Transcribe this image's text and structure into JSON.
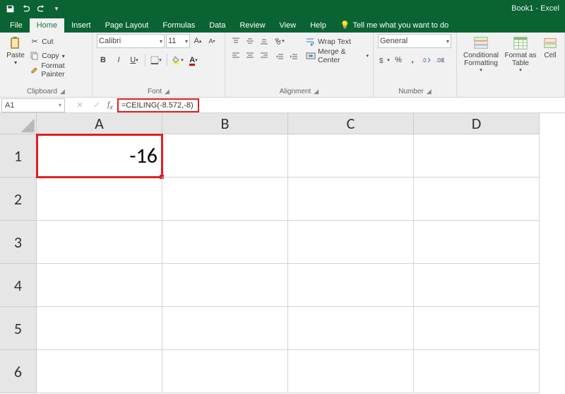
{
  "titlebar": {
    "doc_title": "Book1 - Excel"
  },
  "tabs": {
    "file": "File",
    "home": "Home",
    "insert": "Insert",
    "page_layout": "Page Layout",
    "formulas": "Formulas",
    "data": "Data",
    "review": "Review",
    "view": "View",
    "help": "Help",
    "tell_me": "Tell me what you want to do"
  },
  "clipboard": {
    "paste": "Paste",
    "cut": "Cut",
    "copy": "Copy",
    "format_painter": "Format Painter",
    "group": "Clipboard"
  },
  "font": {
    "name": "Calibri",
    "size": "11",
    "group": "Font"
  },
  "alignment": {
    "wrap": "Wrap Text",
    "merge": "Merge & Center",
    "group": "Alignment"
  },
  "number": {
    "format": "General",
    "group": "Number"
  },
  "styles": {
    "cond": "Conditional Formatting",
    "table": "Format as Table",
    "cell": "Cell"
  },
  "namebox": "A1",
  "formula": "=CEILING(-8.572,-8)",
  "columns": [
    "A",
    "B",
    "C",
    "D"
  ],
  "rows": [
    "1",
    "2",
    "3",
    "4",
    "5",
    "6"
  ],
  "cells": {
    "A1": "-16"
  }
}
